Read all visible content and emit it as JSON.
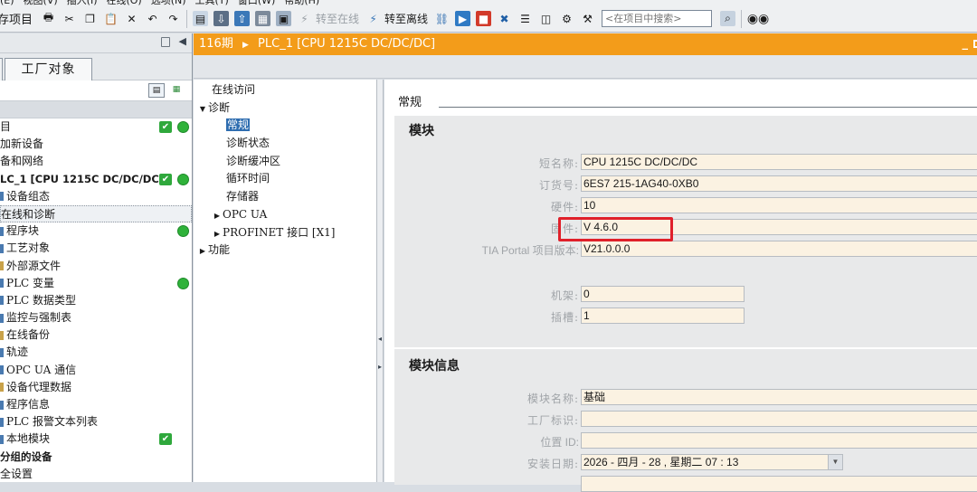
{
  "menubar": [
    "(E)",
    "视图(V)",
    "插入(I)",
    "在线(O)",
    "选项(N)",
    "工具(T)",
    "窗口(W)",
    "帮助(H)"
  ],
  "toolbar": {
    "save_project": "存项目",
    "go_online": "转至在线",
    "go_offline": "转至离线",
    "search_placeholder": "<在项目中搜索>"
  },
  "left_panel": {
    "tab_label": "工厂对象",
    "tree": [
      {
        "label": "目",
        "bold": false,
        "check": true,
        "dot": true,
        "indent": 0
      },
      {
        "label": "加新设备",
        "indent": 0
      },
      {
        "label": "备和网络",
        "indent": 0
      },
      {
        "label": "LC_1 [CPU 1215C DC/DC/DC]",
        "bold": true,
        "check": true,
        "dot": true,
        "indent": 0
      },
      {
        "label": "设备组态",
        "indent": 1,
        "stem": "b"
      },
      {
        "label": "在线和诊断",
        "indent": 1,
        "focus": true
      },
      {
        "label": "程序块",
        "indent": 1,
        "stem": "b",
        "dot": true
      },
      {
        "label": "工艺对象",
        "indent": 1,
        "stem": "b"
      },
      {
        "label": "外部源文件",
        "indent": 1,
        "stem": "o"
      },
      {
        "label": "PLC 变量",
        "indent": 1,
        "stem": "b",
        "dot": true
      },
      {
        "label": "PLC 数据类型",
        "indent": 1,
        "stem": "b"
      },
      {
        "label": "监控与强制表",
        "indent": 1,
        "stem": "b"
      },
      {
        "label": "在线备份",
        "indent": 1,
        "stem": "o"
      },
      {
        "label": "轨迹",
        "indent": 1,
        "stem": "b"
      },
      {
        "label": "OPC UA 通信",
        "indent": 1,
        "stem": "b"
      },
      {
        "label": "设备代理数据",
        "indent": 1,
        "stem": "o"
      },
      {
        "label": "程序信息",
        "indent": 1,
        "stem": "b"
      },
      {
        "label": "PLC 报警文本列表",
        "indent": 1,
        "stem": "b"
      },
      {
        "label": "本地模块",
        "indent": 1,
        "stem": "b",
        "check": true
      },
      {
        "label": "分组的设备",
        "bold": true,
        "indent": 0
      },
      {
        "label": "全设置",
        "indent": 0
      }
    ]
  },
  "editor": {
    "breadcrumb_project": "116期",
    "breadcrumb_device": "PLC_1 [CPU 1215C DC/DC/DC]"
  },
  "nav": [
    {
      "label": "在线访问",
      "level": 0,
      "tri": ""
    },
    {
      "label": "诊断",
      "level": 0,
      "tri": "▼"
    },
    {
      "label": "常规",
      "level": 1,
      "selected": true
    },
    {
      "label": "诊断状态",
      "level": 1
    },
    {
      "label": "诊断缓冲区",
      "level": 1
    },
    {
      "label": "循环时间",
      "level": 1
    },
    {
      "label": "存储器",
      "level": 1
    },
    {
      "label": "OPC UA",
      "level": 1,
      "tri": "▶"
    },
    {
      "label": "PROFINET 接口 [X1]",
      "level": 1,
      "tri": "▶"
    },
    {
      "label": "功能",
      "level": 0,
      "tri": "▶"
    }
  ],
  "properties": {
    "category": "常规",
    "module": {
      "title": "模块",
      "short_name_label": "短名称:",
      "short_name": "CPU 1215C DC/DC/DC",
      "order_no_label": "订货号:",
      "order_no": "6ES7 215-1AG40-0XB0",
      "hardware_label": "硬件:",
      "hardware": "10",
      "firmware_label": "固件:",
      "firmware": "V 4.6.0",
      "tia_label": "TIA Portal 项目版本:",
      "tia_version": "V21.0.0.0",
      "rack_label": "机架:",
      "rack": "0",
      "slot_label": "插槽:",
      "slot": "1"
    },
    "module_info": {
      "title": "模块信息",
      "module_name_label": "模块名称:",
      "module_name": "基础",
      "plant_id_label": "工厂标识:",
      "plant_id": "",
      "location_id_label": "位置 ID:",
      "location_id": "",
      "install_date_label": "安装日期:",
      "install_date": "2026 - 四月 - 28 , 星期二   07 : 13"
    }
  },
  "colors": {
    "title_bar": "#f39c1a",
    "selection": "#2e6db0",
    "ok_green": "#2fb23a",
    "highlight_red": "#e0202a",
    "field_bg": "#fbf2e2"
  }
}
